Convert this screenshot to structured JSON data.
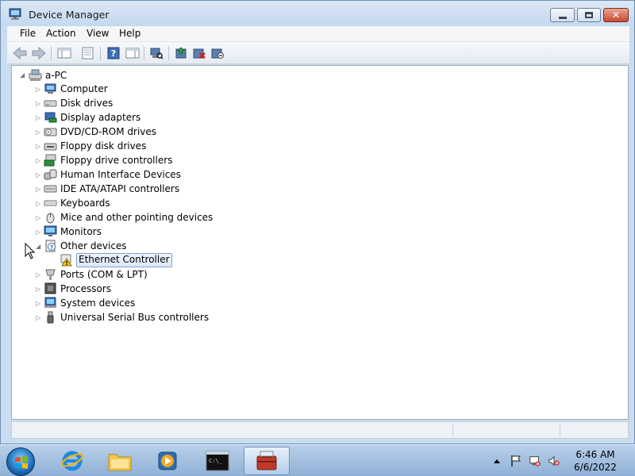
{
  "window": {
    "title": "Device Manager",
    "minimize_icon": "minimize-icon",
    "maximize_icon": "maximize-icon",
    "close_icon": "close-icon"
  },
  "menu": [
    {
      "label": "File"
    },
    {
      "label": "Action"
    },
    {
      "label": "View"
    },
    {
      "label": "Help"
    }
  ],
  "toolbar": {
    "buttons": [
      {
        "icon": "back-arrow-icon"
      },
      {
        "icon": "forward-arrow-icon"
      },
      {
        "icon": "show-hide-console-tree-icon"
      },
      {
        "icon": "properties-icon"
      },
      {
        "icon": "help-icon"
      },
      {
        "icon": "show-action-pane-icon"
      },
      {
        "icon": "scan-hardware-changes-icon"
      },
      {
        "icon": "update-driver-icon"
      },
      {
        "icon": "uninstall-device-icon"
      },
      {
        "icon": "disable-device-icon"
      }
    ]
  },
  "tree": {
    "root": "a-PC",
    "categories": [
      {
        "label": "Computer",
        "icon": "computer-icon"
      },
      {
        "label": "Disk drives",
        "icon": "disk-drive-icon"
      },
      {
        "label": "Display adapters",
        "icon": "display-adapter-icon"
      },
      {
        "label": "DVD/CD-ROM drives",
        "icon": "dvd-drive-icon"
      },
      {
        "label": "Floppy disk drives",
        "icon": "floppy-drive-icon"
      },
      {
        "label": "Floppy drive controllers",
        "icon": "floppy-controller-icon"
      },
      {
        "label": "Human Interface Devices",
        "icon": "hid-icon"
      },
      {
        "label": "IDE ATA/ATAPI controllers",
        "icon": "ide-controller-icon"
      },
      {
        "label": "Keyboards",
        "icon": "keyboard-icon"
      },
      {
        "label": "Mice and other pointing devices",
        "icon": "mouse-icon"
      },
      {
        "label": "Monitors",
        "icon": "monitor-icon"
      },
      {
        "label": "Other devices",
        "icon": "unknown-device-icon",
        "expanded": true,
        "children": [
          {
            "label": "Ethernet Controller",
            "icon": "warning-device-icon",
            "selected": true
          }
        ]
      },
      {
        "label": "Ports (COM & LPT)",
        "icon": "port-icon"
      },
      {
        "label": "Processors",
        "icon": "processor-icon"
      },
      {
        "label": "System devices",
        "icon": "system-device-icon"
      },
      {
        "label": "Universal Serial Bus controllers",
        "icon": "usb-icon"
      }
    ]
  },
  "taskbar": {
    "start_icon": "windows-start-icon",
    "pinned": [
      {
        "icon": "internet-explorer-icon"
      },
      {
        "icon": "file-explorer-icon"
      },
      {
        "icon": "media-player-icon"
      },
      {
        "icon": "command-prompt-icon"
      },
      {
        "icon": "device-manager-icon",
        "active": true
      }
    ],
    "tray": [
      {
        "icon": "show-hidden-icons-icon"
      },
      {
        "icon": "action-center-flag-icon"
      },
      {
        "icon": "network-icon"
      },
      {
        "icon": "volume-muted-icon"
      }
    ],
    "clock": {
      "time": "6:46 AM",
      "date": "6/6/2022"
    }
  }
}
